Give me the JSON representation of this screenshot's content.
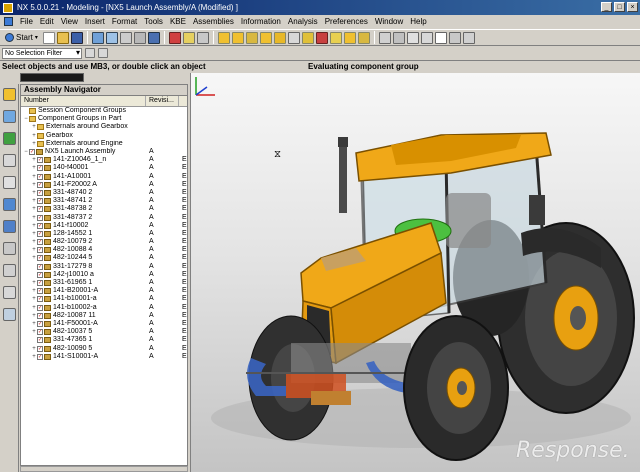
{
  "window": {
    "title": "NX 5.0.0.21 - Modeling - [NX5 Launch Assembly/A (Modified) ]"
  },
  "menu": [
    "File",
    "Edit",
    "View",
    "Insert",
    "Format",
    "Tools",
    "KBE",
    "Assemblies",
    "Information",
    "Analysis",
    "Preferences",
    "Window",
    "Help"
  ],
  "toolbar": {
    "start_label": "Start",
    "filter_value": "No Selection Filter"
  },
  "cue_line": {
    "cue": "Select objects and use MB3, or double click an object",
    "status": "Evaluating component group"
  },
  "navigator": {
    "title": "Assembly Navigator",
    "col_number": "Number",
    "col_revision": "Revisi...",
    "rows": [
      {
        "label": "Session Component Groups",
        "rev": "",
        "ex": "",
        "indent": 0,
        "icon": "folder",
        "check": false,
        "expander": ""
      },
      {
        "label": "Component Groups in Part",
        "rev": "",
        "ex": "",
        "indent": 0,
        "icon": "folder",
        "check": false,
        "expander": "−"
      },
      {
        "label": "Externals around Gearbox",
        "rev": "",
        "ex": "",
        "indent": 1,
        "icon": "folder",
        "check": false,
        "expander": "+"
      },
      {
        "label": "Gearbox",
        "rev": "",
        "ex": "",
        "indent": 1,
        "icon": "folder",
        "check": false,
        "expander": "+"
      },
      {
        "label": "Externals around Engine",
        "rev": "",
        "ex": "",
        "indent": 1,
        "icon": "folder",
        "check": false,
        "expander": "+"
      },
      {
        "label": "NX5 Launch Assembly",
        "rev": "A",
        "ex": "",
        "indent": 0,
        "icon": "part",
        "check": true,
        "expander": "−"
      },
      {
        "label": "141-Z10046_1_n",
        "rev": "A",
        "ex": "E",
        "indent": 1,
        "icon": "part",
        "check": true,
        "expander": "+"
      },
      {
        "label": "140-f40001",
        "rev": "A",
        "ex": "E",
        "indent": 1,
        "icon": "part",
        "check": true,
        "expander": "+"
      },
      {
        "label": "141-A10001",
        "rev": "A",
        "ex": "E",
        "indent": 1,
        "icon": "part",
        "check": true,
        "expander": "+"
      },
      {
        "label": "141-F20002 A",
        "rev": "A",
        "ex": "E",
        "indent": 1,
        "icon": "part",
        "check": true,
        "expander": "+"
      },
      {
        "label": "331-48740 2",
        "rev": "A",
        "ex": "E",
        "indent": 1,
        "icon": "part",
        "check": true,
        "expander": "+"
      },
      {
        "label": "331-48741 2",
        "rev": "A",
        "ex": "E",
        "indent": 1,
        "icon": "part",
        "check": true,
        "expander": "+"
      },
      {
        "label": "331-48738 2",
        "rev": "A",
        "ex": "E",
        "indent": 1,
        "icon": "part",
        "check": true,
        "expander": "+"
      },
      {
        "label": "331-48737 2",
        "rev": "A",
        "ex": "E",
        "indent": 1,
        "icon": "part",
        "check": true,
        "expander": "+"
      },
      {
        "label": "141-f10002",
        "rev": "A",
        "ex": "E",
        "indent": 1,
        "icon": "part",
        "check": true,
        "expander": "+"
      },
      {
        "label": "128-14552 1",
        "rev": "A",
        "ex": "E",
        "indent": 1,
        "icon": "part",
        "check": true,
        "expander": "+"
      },
      {
        "label": "482-10079 2",
        "rev": "A",
        "ex": "E",
        "indent": 1,
        "icon": "part",
        "check": true,
        "expander": "+"
      },
      {
        "label": "482-10088 4",
        "rev": "A",
        "ex": "E",
        "indent": 1,
        "icon": "part",
        "check": true,
        "expander": "+"
      },
      {
        "label": "482-10244 5",
        "rev": "A",
        "ex": "E",
        "indent": 1,
        "icon": "part",
        "check": true,
        "expander": "+"
      },
      {
        "label": "331-17279 8",
        "rev": "A",
        "ex": "E",
        "indent": 1,
        "icon": "part",
        "check": true,
        "expander": ""
      },
      {
        "label": "142-j10010 a",
        "rev": "A",
        "ex": "E",
        "indent": 1,
        "icon": "part",
        "check": true,
        "expander": ""
      },
      {
        "label": "331-61965 1",
        "rev": "A",
        "ex": "E",
        "indent": 1,
        "icon": "part",
        "check": true,
        "expander": "+"
      },
      {
        "label": "141-B20001-A",
        "rev": "A",
        "ex": "E",
        "indent": 1,
        "icon": "part",
        "check": true,
        "expander": "+"
      },
      {
        "label": "141-b10001-a",
        "rev": "A",
        "ex": "E",
        "indent": 1,
        "icon": "part",
        "check": true,
        "expander": "+"
      },
      {
        "label": "141-b10002-a",
        "rev": "A",
        "ex": "E",
        "indent": 1,
        "icon": "part",
        "check": true,
        "expander": "+"
      },
      {
        "label": "482-10087 11",
        "rev": "A",
        "ex": "E",
        "indent": 1,
        "icon": "part",
        "check": true,
        "expander": "+"
      },
      {
        "label": "141-F50001-A",
        "rev": "A",
        "ex": "E",
        "indent": 1,
        "icon": "part",
        "check": true,
        "expander": "+"
      },
      {
        "label": "482-10037 5",
        "rev": "A",
        "ex": "E",
        "indent": 1,
        "icon": "part",
        "check": true,
        "expander": "+"
      },
      {
        "label": "331-47365 1",
        "rev": "A",
        "ex": "E",
        "indent": 1,
        "icon": "part",
        "check": true,
        "expander": ""
      },
      {
        "label": "482-10090 5",
        "rev": "A",
        "ex": "E",
        "indent": 1,
        "icon": "part",
        "check": true,
        "expander": "+"
      },
      {
        "label": "141-S10001-A",
        "rev": "A",
        "ex": "E",
        "indent": 1,
        "icon": "part",
        "check": true,
        "expander": "+"
      }
    ]
  },
  "viewport": {
    "watermark": "Response."
  },
  "colors": {
    "tractor_body": "#f0a818",
    "tyre": "#2e2e2e",
    "hub": "#e8a010",
    "frame": "#3a3a3a",
    "glass": "#c8d8e0"
  }
}
